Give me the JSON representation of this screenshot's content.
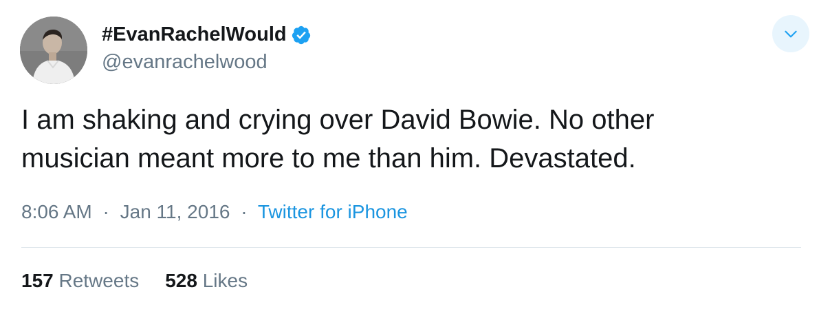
{
  "user": {
    "display_name": "#EvanRachelWould",
    "handle": "@evanrachelwood",
    "verified_icon": "verified-badge-icon",
    "avatar_icon": "profile-photo"
  },
  "menu": {
    "icon": "chevron-down-icon"
  },
  "tweet": {
    "text_lines": [
      "I am shaking and crying over David Bowie. No other",
      "musician meant more to me than him. Devastated."
    ],
    "time": "8:06 AM",
    "separator": "·",
    "date": "Jan 11, 2016",
    "source": "Twitter for iPhone"
  },
  "stats": {
    "retweets_count": "157",
    "retweets_label": "Retweets",
    "likes_count": "528",
    "likes_label": "Likes"
  },
  "colors": {
    "accent": "#1b95e0",
    "verified": "#1da1f2",
    "secondary_text": "#657786",
    "primary_text": "#14171a",
    "divider": "#e1e8ed",
    "menu_bg": "#e8f5fd"
  }
}
